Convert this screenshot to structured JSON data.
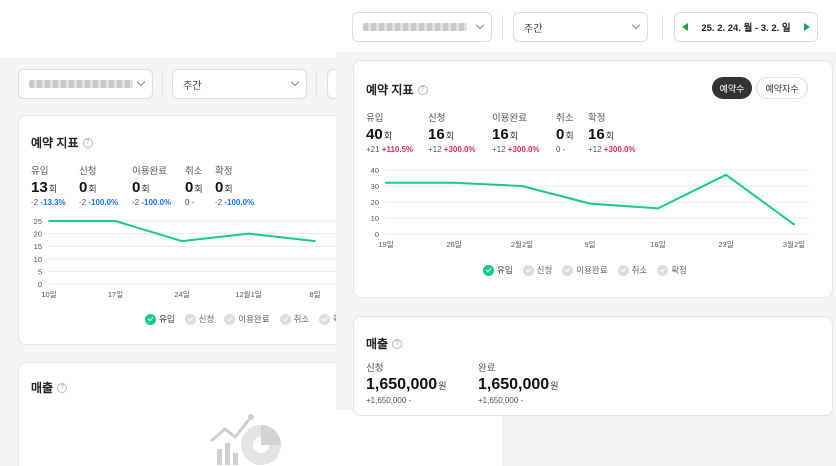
{
  "back": {
    "filters": {
      "period_value": "주간"
    },
    "reservation_card": {
      "title": "예약 지표",
      "metrics": [
        {
          "label": "유입",
          "value": "13",
          "unit": "회",
          "delta": "-2",
          "pct": "-13.3%"
        },
        {
          "label": "신청",
          "value": "0",
          "unit": "회",
          "delta": "-2",
          "pct": "-100.0%"
        },
        {
          "label": "이용완료",
          "value": "0",
          "unit": "회",
          "delta": "-2",
          "pct": "-100.0%"
        },
        {
          "label": "취소",
          "value": "0",
          "unit": "회",
          "delta": "0",
          "pct": "-"
        },
        {
          "label": "확정",
          "value": "0",
          "unit": "회",
          "delta": "-2",
          "pct": "-100.0%"
        }
      ],
      "legend": [
        "유입",
        "신청",
        "이용완료",
        "취소",
        "확"
      ]
    },
    "sales_card": {
      "title": "매출"
    }
  },
  "front": {
    "filters": {
      "period_value": "주간",
      "date_range": "25. 2. 24. 월 - 3. 2. 일"
    },
    "reservation_card": {
      "title": "예약 지표",
      "toggle": {
        "left": "예약수",
        "right": "예약자수"
      },
      "metrics": [
        {
          "label": "유입",
          "value": "40",
          "unit": "회",
          "delta": "+21",
          "pct": "+110.5%"
        },
        {
          "label": "신청",
          "value": "16",
          "unit": "회",
          "delta": "+12",
          "pct": "+300.0%"
        },
        {
          "label": "이용완료",
          "value": "16",
          "unit": "회",
          "delta": "+12",
          "pct": "+300.0%"
        },
        {
          "label": "취소",
          "value": "0",
          "unit": "회",
          "delta": "0",
          "pct": "-"
        },
        {
          "label": "확정",
          "value": "16",
          "unit": "회",
          "delta": "+12",
          "pct": "+300.0%"
        }
      ],
      "legend": [
        "유입",
        "신청",
        "이용완료",
        "취소",
        "확정"
      ]
    },
    "sales_card": {
      "title": "매출",
      "metrics": [
        {
          "label": "신청",
          "value": "1,650,000",
          "unit": "원",
          "delta": "+1,650,000",
          "pct": "-"
        },
        {
          "label": "완료",
          "value": "1,650,000",
          "unit": "원",
          "delta": "+1,650,000",
          "pct": "-"
        }
      ]
    }
  },
  "colors": {
    "line": "#16c98d",
    "accent": "#16a34a",
    "negative": "#1a73e8",
    "positive": "#e52b50"
  },
  "chart_data": [
    {
      "type": "line",
      "x": [
        "10일",
        "17일",
        "24일",
        "12월1일",
        "8일"
      ],
      "series": [
        {
          "name": "유입",
          "values": [
            25,
            25,
            17,
            20,
            17
          ]
        }
      ],
      "y_ticks": [
        0,
        5,
        10,
        15,
        20,
        25
      ],
      "ylim": [
        0,
        25
      ],
      "grid": true
    },
    {
      "type": "line",
      "x": [
        "19일",
        "26일",
        "2월2일",
        "9일",
        "16일",
        "23일",
        "3월2일"
      ],
      "series": [
        {
          "name": "유입",
          "values": [
            32,
            32,
            30,
            19,
            16,
            37,
            6
          ]
        }
      ],
      "y_ticks": [
        0,
        10,
        20,
        30,
        40
      ],
      "ylim": [
        0,
        40
      ],
      "grid": true
    }
  ]
}
